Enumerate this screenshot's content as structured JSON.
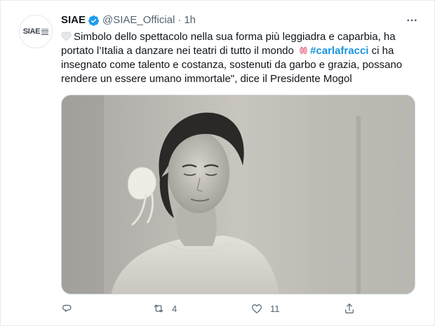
{
  "tweet": {
    "author_name": "SIAE",
    "handle": "@SIAE_Official",
    "separator": "·",
    "time": "1h",
    "avatar_logo": "SIAE",
    "text_before_hashtag": "Simbolo dello spettacolo nella sua forma più leggiadra e caparbia, ha portato l’Italia a danzare nei teatri di tutto il mondo",
    "hashtag": "#carlafracci",
    "text_after_hashtag": " ci ha insegnato come talento e costanza, sostenuti da garbo e grazia, possano rendere un essere umano immortale\", dice il Presidente Mogol",
    "icons": {
      "verified": "verified-badge-icon",
      "more": "more-options-icon",
      "leading_emoji": "white-heart-emoji-icon",
      "inline_emoji": "ballet-shoes-emoji-icon"
    },
    "colors": {
      "accent": "#1d9bf0",
      "hashtag": "#1b95e0",
      "muted": "#536471"
    },
    "media": {
      "type": "black-and-white photo"
    },
    "actions": {
      "reply_count": "",
      "retweet_count": "4",
      "like_count": "11",
      "share_count": ""
    }
  }
}
